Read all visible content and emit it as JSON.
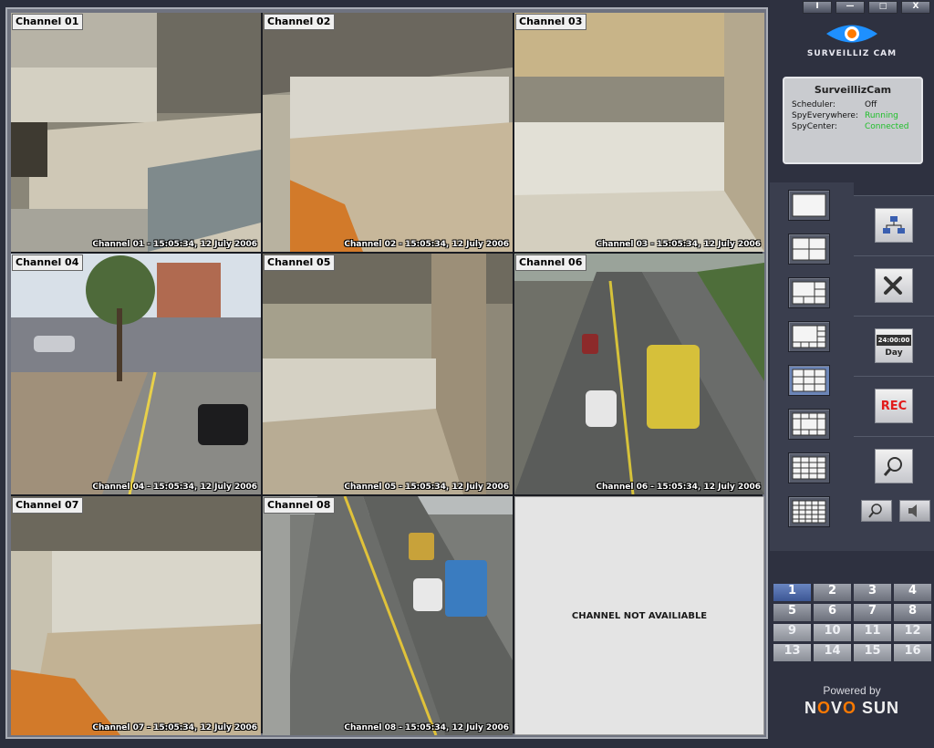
{
  "window_buttons": [
    "I",
    "—",
    "□",
    "X"
  ],
  "brand": {
    "name": "SURVEILLIZ CAM",
    "accent": "#1e90ff"
  },
  "status": {
    "title": "SurveillizCam",
    "rows": [
      {
        "key": "Scheduler:",
        "value": "Off",
        "color": "#111111"
      },
      {
        "key": "SpyEverywhere:",
        "value": "Running",
        "color": "#1fbf2a"
      },
      {
        "key": "SpyCenter:",
        "value": "Connected",
        "color": "#1fbf2a"
      }
    ]
  },
  "channels": [
    {
      "label": "Channel 01",
      "stamp": "Channel 01 - 15:05:34, 12 July 2006"
    },
    {
      "label": "Channel 02",
      "stamp": "Channel 02 - 15:05:34, 12 July 2006"
    },
    {
      "label": "Channel 03",
      "stamp": "Channel 03 - 15:05:34, 12 July 2006"
    },
    {
      "label": "Channel 04",
      "stamp": "Channel 04 - 15:05:34, 12 July 2006"
    },
    {
      "label": "Channel 05",
      "stamp": "Channel 05 - 15:05:34, 12 July 2006"
    },
    {
      "label": "Channel 06",
      "stamp": "Channel 06 - 15:05:34, 12 July 2006"
    },
    {
      "label": "Channel 07",
      "stamp": "Channel 07 - 15:05:34, 12 July 2006"
    },
    {
      "label": "Channel 08",
      "stamp": "Channel 08 - 15:05:34, 12 July 2006"
    }
  ],
  "empty_cell_text": "CHANNEL NOT AVAILIABLE",
  "tools": {
    "rec_label": "REC",
    "day_label": "Day",
    "clock_text": "24:00:00"
  },
  "numpad": [
    "1",
    "2",
    "3",
    "4",
    "5",
    "6",
    "7",
    "8",
    "9",
    "10",
    "11",
    "12",
    "13",
    "14",
    "15",
    "16"
  ],
  "numpad_selected": "1",
  "powered": {
    "label": "Powered by",
    "logo_left": "N",
    "logo_o1": "O",
    "logo_mid": "V",
    "logo_o2": "O",
    "logo_right": " SUN"
  }
}
